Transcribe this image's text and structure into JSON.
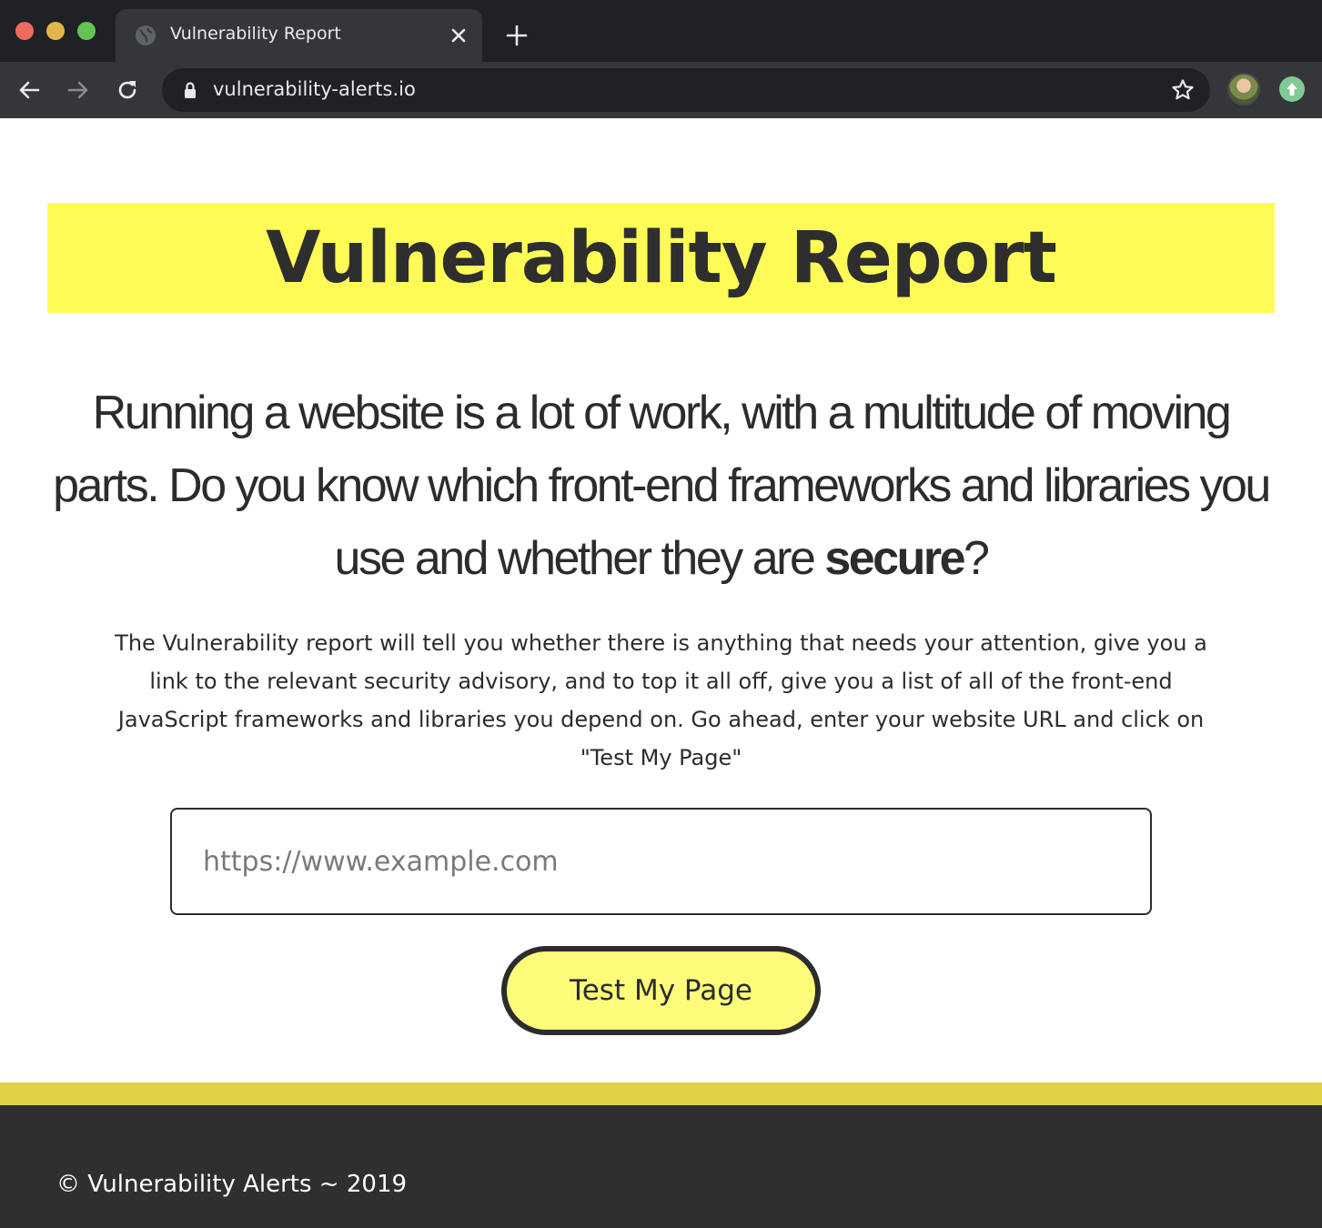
{
  "browser": {
    "tab_title": "Vulnerability Report",
    "url": "vulnerability-alerts.io",
    "icons": [
      "back-arrow-icon",
      "forward-arrow-icon",
      "reload-icon",
      "lock-icon",
      "star-icon",
      "globe-icon",
      "close-icon",
      "plus-icon",
      "profile-avatar",
      "update-icon"
    ]
  },
  "hero": {
    "title": "Vulnerability Report"
  },
  "lead": {
    "text_before": "Running a website is a lot of work, with a multitude of moving parts. Do you know which front-end frameworks and libraries you use and whether they are ",
    "emphasis": "secure",
    "text_after": "?"
  },
  "description": "The Vulnerability report will tell you whether there is anything that needs your attention, give you a link to the relevant security advisory, and to top it all off, give you a list of all of the front-end JavaScript frameworks and libraries you depend on. Go ahead, enter your website URL and click on \"Test My Page\"",
  "form": {
    "url_placeholder": "https://www.example.com",
    "submit_label": "Test My Page"
  },
  "footer": {
    "copyright": "© Vulnerability Alerts ~ 2019"
  },
  "colors": {
    "accent_yellow": "#fefb56",
    "button_yellow": "#fcfc7a",
    "footer_stripe": "#e2d046",
    "footer_bg": "#2f2f2f",
    "text_dark": "#2c2c2c"
  }
}
